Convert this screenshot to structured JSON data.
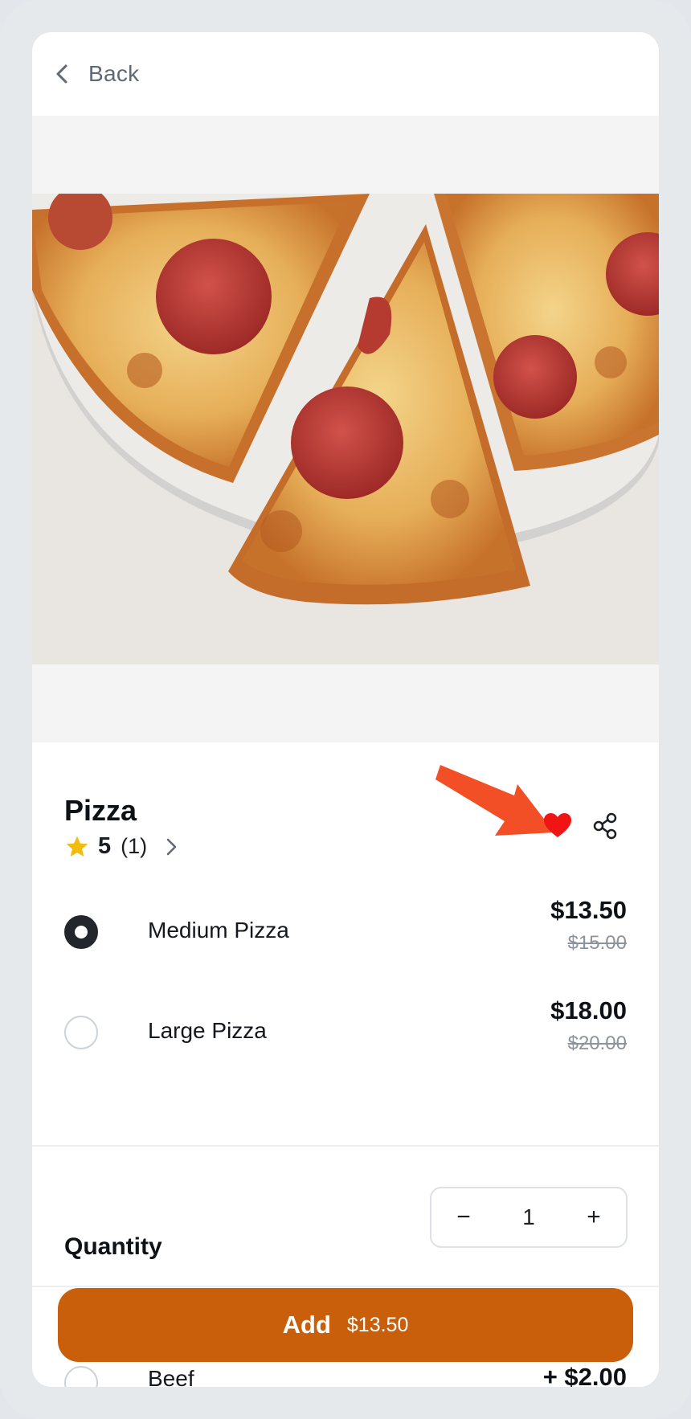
{
  "header": {
    "back_label": "Back"
  },
  "product": {
    "title": "Pizza",
    "rating_value": "5",
    "rating_count": "(1)"
  },
  "options": [
    {
      "label": "Medium Pizza",
      "price": "$13.50",
      "original_price": "$15.00",
      "selected": true
    },
    {
      "label": "Large Pizza",
      "price": "$18.00",
      "original_price": "$20.00",
      "selected": false
    }
  ],
  "addon_peek": {
    "label": "Beef",
    "price": "+ $2.00"
  },
  "quantity": {
    "label": "Quantity",
    "value": "1",
    "minus": "−",
    "plus": "+"
  },
  "cta": {
    "label": "Add",
    "price": "$13.50"
  },
  "colors": {
    "accent": "#c95f0b",
    "heart": "#f01414",
    "star": "#f2bb10",
    "annotation_arrow": "#f24f27"
  }
}
